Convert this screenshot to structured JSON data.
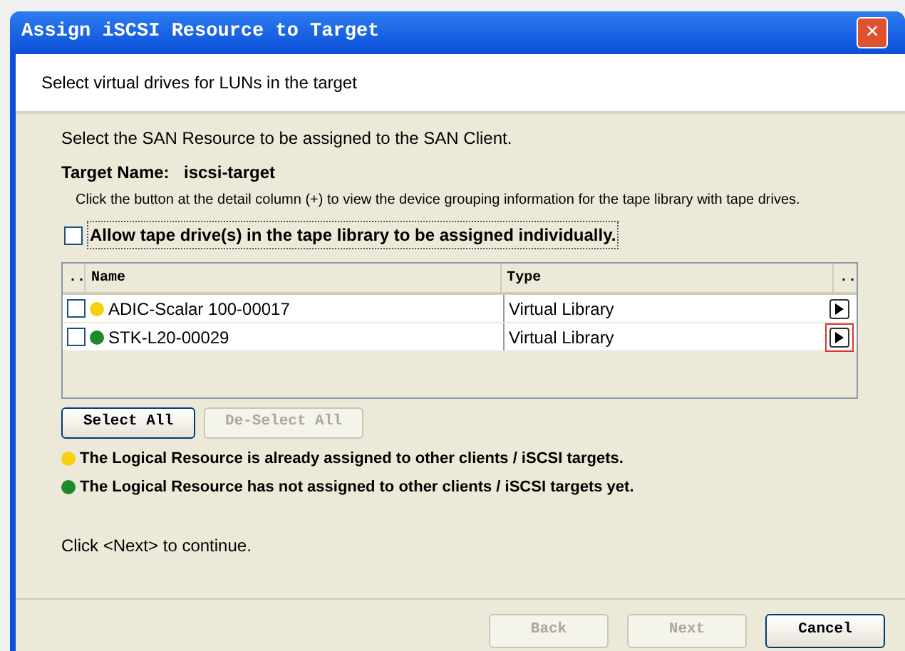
{
  "window": {
    "title": "Assign iSCSI Resource to Target",
    "close": "×"
  },
  "header": {
    "subtitle": "Select virtual drives for LUNs in the target"
  },
  "intro": "Select the SAN Resource to be assigned to the SAN Client.",
  "target": {
    "label": "Target Name:",
    "value": "iscsi-target"
  },
  "hint": "Click the button at the detail column (+) to view the device grouping information for the tape library with tape drives.",
  "allow_individual": {
    "label": "Allow tape drive(s) in the tape library to be assigned individually.",
    "checked": false
  },
  "table": {
    "columns": [
      "..",
      "Name",
      "Type",
      ".."
    ],
    "rows": [
      {
        "checked": false,
        "color": "#f5cf10",
        "name": "ADIC-Scalar 100-00017",
        "type": "Virtual Library",
        "highlighted": false
      },
      {
        "checked": false,
        "color": "#1e8a2a",
        "name": "STK-L20-00029",
        "type": "Virtual Library",
        "highlighted": true
      }
    ]
  },
  "select_buttons": [
    {
      "label": "Select All",
      "disabled": false
    },
    {
      "label": "De-Select All",
      "disabled": true
    }
  ],
  "legend": [
    {
      "color": "#f5cf10",
      "text": "The Logical Resource is already assigned to other clients / iSCSI targets."
    },
    {
      "color": "#1e8a2a",
      "text": "The Logical Resource has not assigned to other clients / iSCSI targets yet."
    }
  ],
  "footer_note": "Click <Next> to continue.",
  "buttons": [
    {
      "label": "Back",
      "disabled": true
    },
    {
      "label": "Next",
      "disabled": true
    },
    {
      "label": "Cancel",
      "disabled": false
    }
  ]
}
